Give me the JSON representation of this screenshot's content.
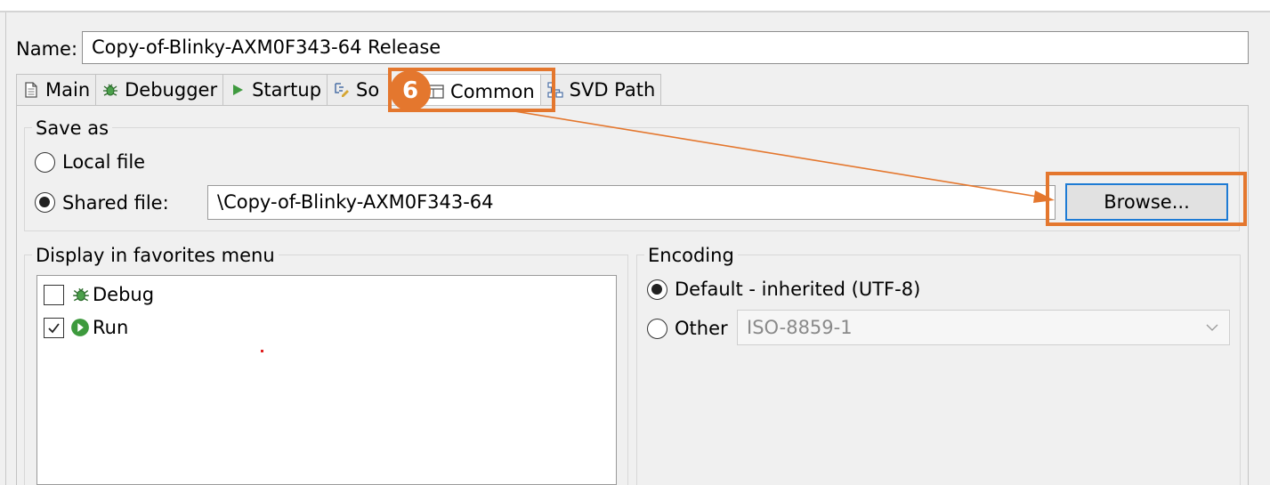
{
  "name_field": {
    "label": "Name:",
    "value": "Copy-of-Blinky-AXM0F343-64 Release"
  },
  "tabs": [
    {
      "label": "Main",
      "icon": "document-icon"
    },
    {
      "label": "Debugger",
      "icon": "bug-icon"
    },
    {
      "label": "Startup",
      "icon": "play-icon"
    },
    {
      "label": "So",
      "icon": "source-icon"
    },
    {
      "label": "Common",
      "icon": "window-icon",
      "active": true
    },
    {
      "label": "SVD Path",
      "icon": "tree-icon"
    }
  ],
  "save_as": {
    "title": "Save as",
    "local_file_label": "Local file",
    "shared_file_label": "Shared file:",
    "shared_file_path": "\\Copy-of-Blinky-AXM0F343-64",
    "browse_label": "Browse...",
    "selected": "shared"
  },
  "favorites": {
    "title": "Display in favorites menu",
    "items": [
      {
        "label": "Debug",
        "checked": false,
        "icon": "bug-icon"
      },
      {
        "label": "Run",
        "checked": true,
        "icon": "run-icon"
      }
    ]
  },
  "encoding": {
    "title": "Encoding",
    "default_label": "Default - inherited (UTF-8)",
    "other_label": "Other",
    "other_value": "ISO-8859-1",
    "selected": "default"
  },
  "annotation": {
    "step_number": "6",
    "color": "#e4772e"
  }
}
